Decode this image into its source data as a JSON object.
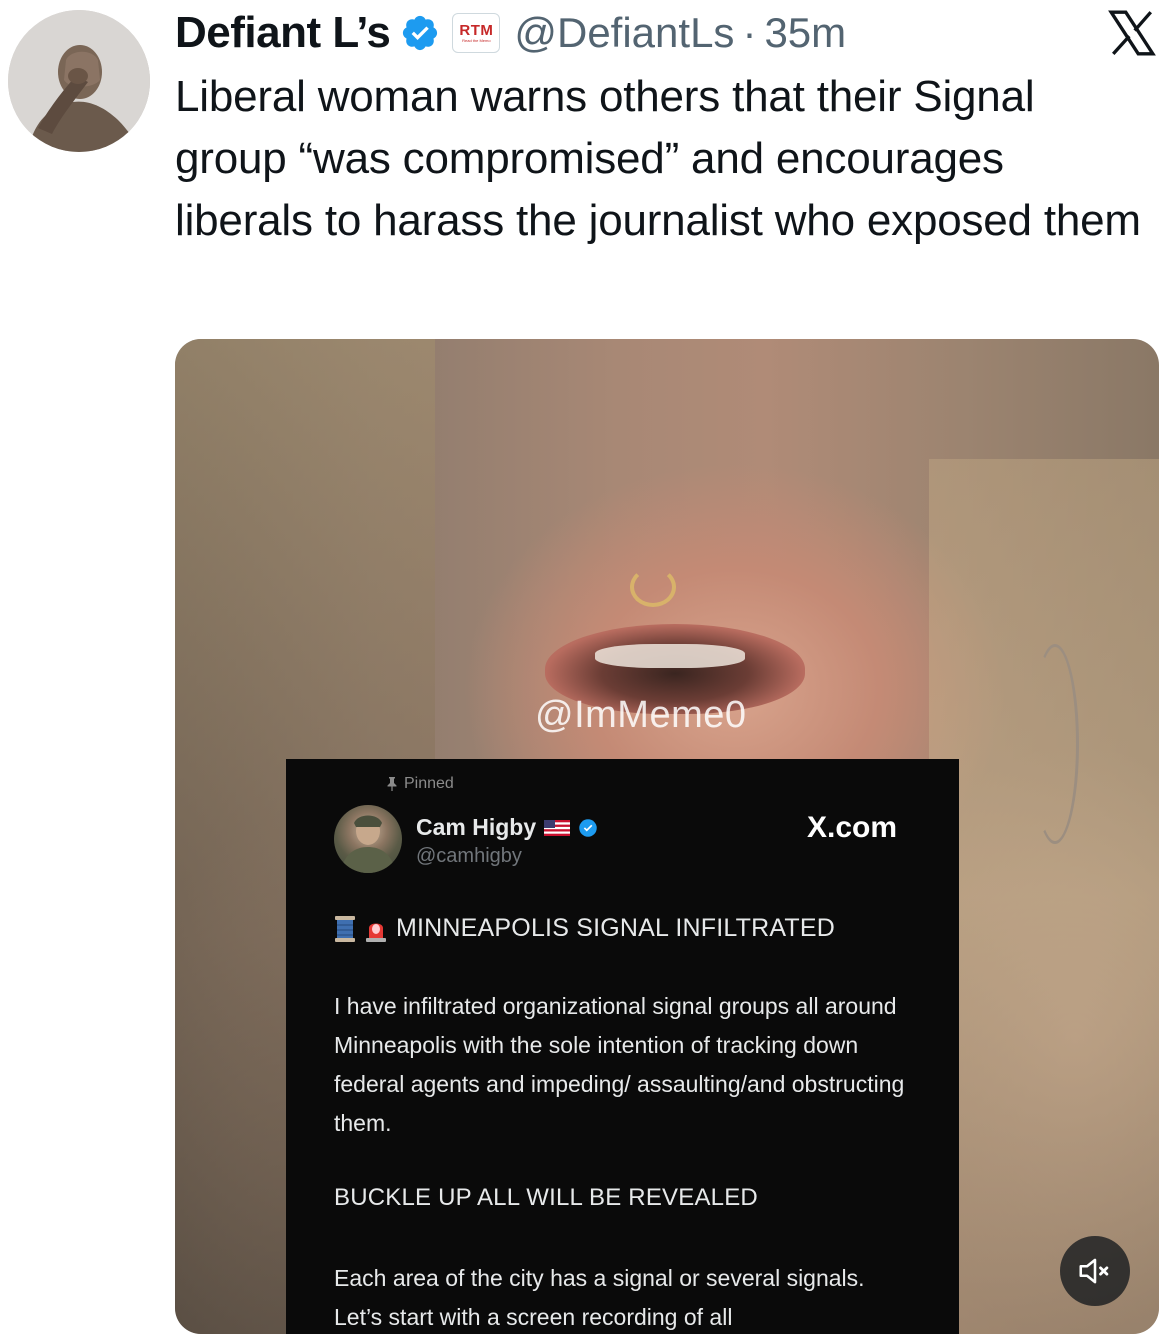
{
  "author": {
    "display_name": "Defiant L’s",
    "affiliate_badge": "RTM",
    "affiliate_badge_subtext": "Read the Memo",
    "handle": "@DefiantLs",
    "separator": "·",
    "time": "35m"
  },
  "tweet": {
    "text": "Liberal woman warns others that their Signal group “was compromised” and encourages liberals to harass the journalist who exposed them"
  },
  "media": {
    "watermark": "@ImMeme0",
    "embedded_post": {
      "pinned_label": "Pinned",
      "name": "Cam Higby",
      "handle": "@camhigby",
      "site": "X.com",
      "headline": "MINNEAPOLIS SIGNAL INFILTRATED",
      "body": "I have infiltrated organizational signal groups all around Minneapolis with the sole intention of tracking down federal agents and impeding/ assaulting/and obstructing them.",
      "buckle": "BUCKLE UP ALL WILL BE REVEALED",
      "body2": "Each area of the city has a signal or several signals. Let’s start with a screen recording of all"
    }
  },
  "colors": {
    "text_primary": "#0f1419",
    "text_secondary": "#536471",
    "verified_blue": "#1d9bf0"
  },
  "icons": {
    "verified": "verified-badge-icon",
    "x_logo": "x-logo-icon",
    "mute": "volume-muted-icon",
    "pin": "pin-icon"
  }
}
